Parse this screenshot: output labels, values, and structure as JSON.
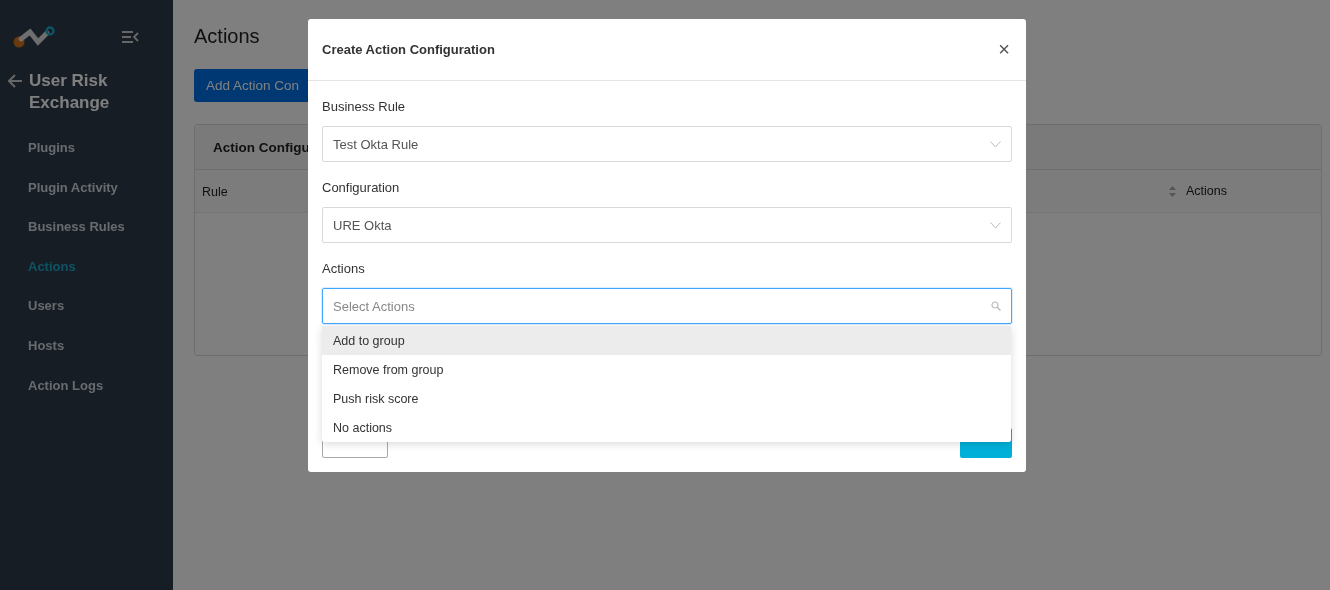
{
  "sidebar": {
    "title": "User Risk Exchange",
    "items": [
      {
        "label": "Plugins",
        "selected": false
      },
      {
        "label": "Plugin Activity",
        "selected": false
      },
      {
        "label": "Business Rules",
        "selected": false
      },
      {
        "label": "Actions",
        "selected": true
      },
      {
        "label": "Users",
        "selected": false
      },
      {
        "label": "Hosts",
        "selected": false
      },
      {
        "label": "Action Logs",
        "selected": false
      }
    ]
  },
  "page": {
    "title": "Actions",
    "add_button": "Add Action Con",
    "card_title": "Action Configu",
    "columns": [
      {
        "label": "Rule",
        "sortable": false
      },
      {
        "sortable": true
      },
      {
        "label": "Actions",
        "sortable": false
      }
    ]
  },
  "modal": {
    "title": "Create Action Configuration",
    "close": "×",
    "fields": [
      {
        "kind": "select",
        "label": "Business Rule",
        "value": "Test Okta Rule",
        "focused": false
      },
      {
        "kind": "select",
        "label": "Configuration",
        "value": "URE Okta",
        "focused": false
      },
      {
        "kind": "search",
        "label": "Actions",
        "placeholder": "Select Actions",
        "focused": true
      }
    ],
    "options": [
      {
        "label": "Add to group",
        "selected": true
      },
      {
        "label": "Remove from group",
        "selected": false
      },
      {
        "label": "Push risk score",
        "selected": false
      },
      {
        "label": "No actions",
        "selected": false
      }
    ],
    "buttons": [
      {
        "kind": "cancel"
      },
      {
        "kind": "save"
      }
    ]
  }
}
